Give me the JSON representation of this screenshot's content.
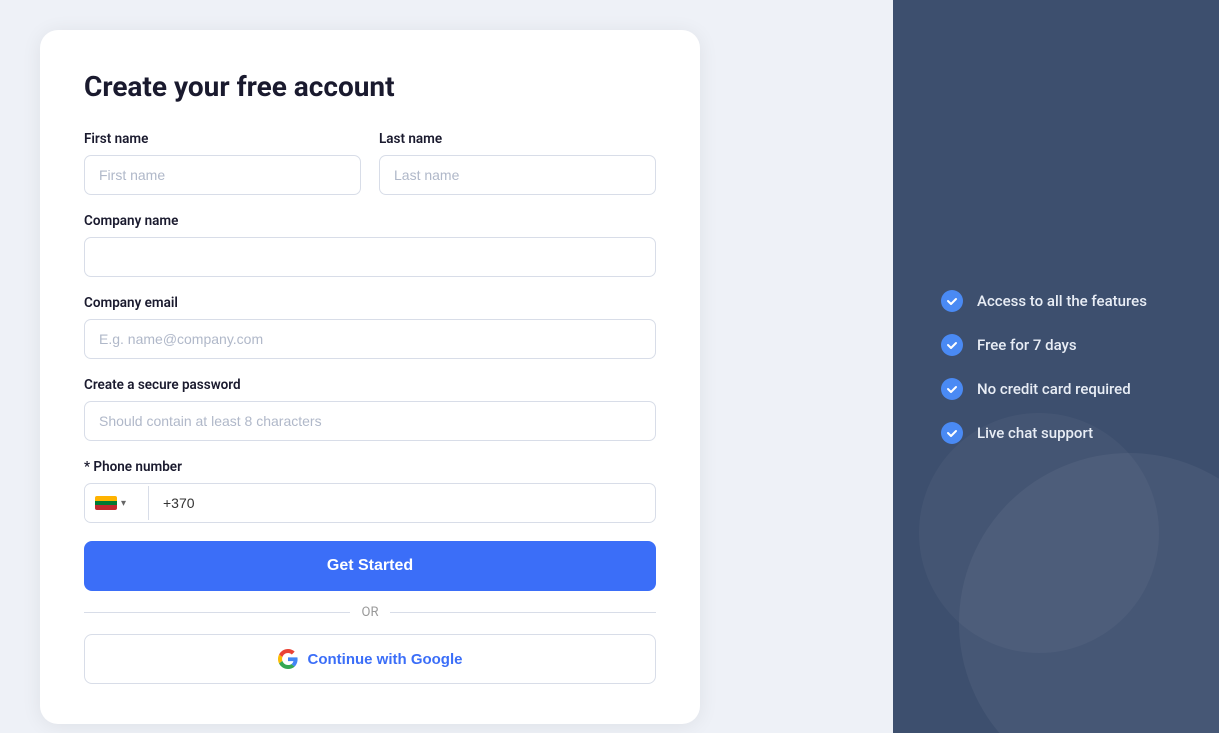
{
  "form": {
    "title": "Create your free account",
    "first_name_label": "First name",
    "first_name_placeholder": "First name",
    "last_name_label": "Last name",
    "last_name_placeholder": "Last name",
    "company_name_label": "Company name",
    "company_name_placeholder": "",
    "company_email_label": "Company email",
    "company_email_placeholder": "E.g. name@company.com",
    "password_label": "Create a secure password",
    "password_placeholder": "Should contain at least 8 characters",
    "phone_label": "* Phone number",
    "phone_code": "+370",
    "or_text": "OR",
    "get_started_label": "Get Started",
    "google_btn_label": "Continue with Google"
  },
  "features": {
    "items": [
      {
        "text": "Access to all the features"
      },
      {
        "text": "Free for 7 days"
      },
      {
        "text": "No credit card required"
      },
      {
        "text": "Live chat support"
      }
    ]
  }
}
